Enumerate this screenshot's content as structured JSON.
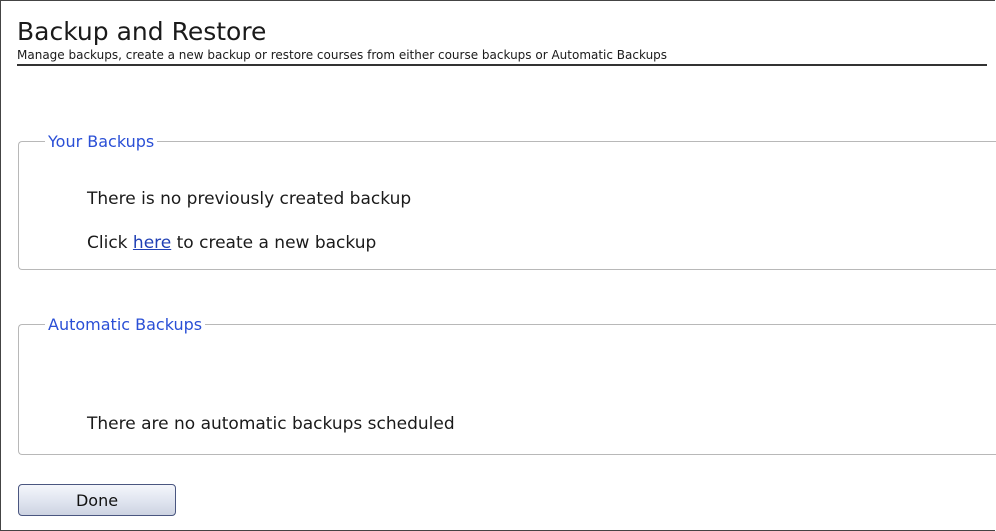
{
  "header": {
    "title": "Backup and Restore",
    "subtitle": "Manage backups, create a new backup or restore courses from either course backups or Automatic Backups"
  },
  "your_backups": {
    "legend": "Your Backups",
    "empty_message": "There is no previously created backup",
    "create_prefix": "Click ",
    "create_link": "here",
    "create_suffix": " to create a new backup"
  },
  "automatic_backups": {
    "legend": "Automatic Backups",
    "empty_message": "There are no automatic backups scheduled"
  },
  "actions": {
    "done_label": "Done"
  },
  "colors": {
    "legend": "#2a4fd6",
    "link": "#1f3fb4"
  }
}
